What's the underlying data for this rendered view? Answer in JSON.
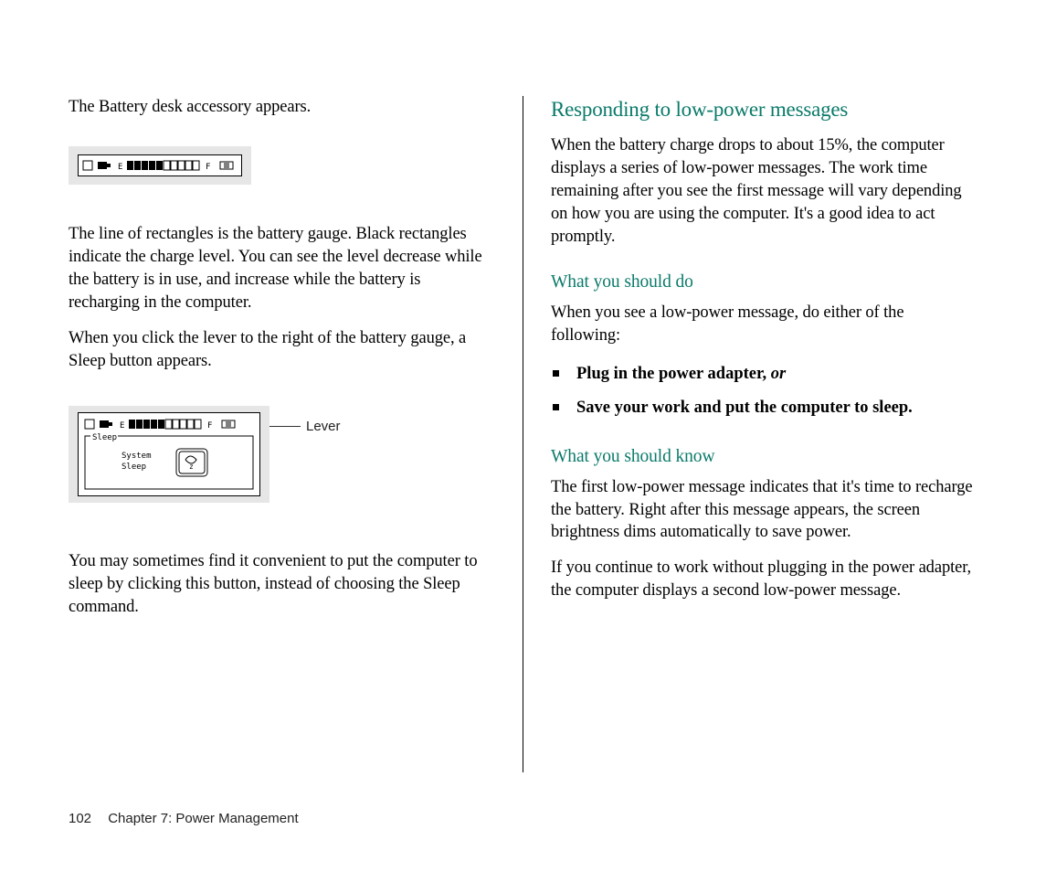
{
  "left": {
    "p1": "The Battery desk accessory appears.",
    "p2": "The line of rectangles is the battery gauge. Black rectangles indicate the charge level. You can see the level decrease while the battery is in use, and increase while the battery is recharging in the computer.",
    "p3": "When you click the lever to the right of the battery gauge, a Sleep button appears.",
    "p4": "You may sometimes find it convenient to put the computer to sleep by clicking this button, instead of choosing the Sleep command.",
    "lever_label": "Lever"
  },
  "right": {
    "h2": "Responding to low-power messages",
    "p1": "When the battery charge drops to about 15%, the computer displays a series of low-power messages. The work time remaining after you see the first message will vary depending on how you are using the computer. It's a good idea to act promptly.",
    "h3a": "What you should do",
    "p2": "When you see a low-power message, do either of the following:",
    "bullet1_strong": "Plug in the power adapter,",
    "bullet1_or": " or",
    "bullet2": "Save your work and put the computer to sleep.",
    "h3b": "What you should know",
    "p3": "The first low-power message indicates that it's time to recharge the battery. Right after this message appears, the screen brightness dims automatically to save power.",
    "p4": "If you continue to work without plugging in the power adapter, the computer displays a second low-power message."
  },
  "figure": {
    "gauge_empty": "E",
    "gauge_full": "F",
    "sleep_panel_title": "Sleep",
    "sleep_line1": "System",
    "sleep_line2": "Sleep",
    "battery_cells_total": 10,
    "battery_cells_filled": 5
  },
  "footer": {
    "page_number": "102",
    "chapter": "Chapter 7: Power Management"
  },
  "colors": {
    "heading_teal": "#0a7a6a",
    "figure_bg": "#e6e6e6"
  }
}
